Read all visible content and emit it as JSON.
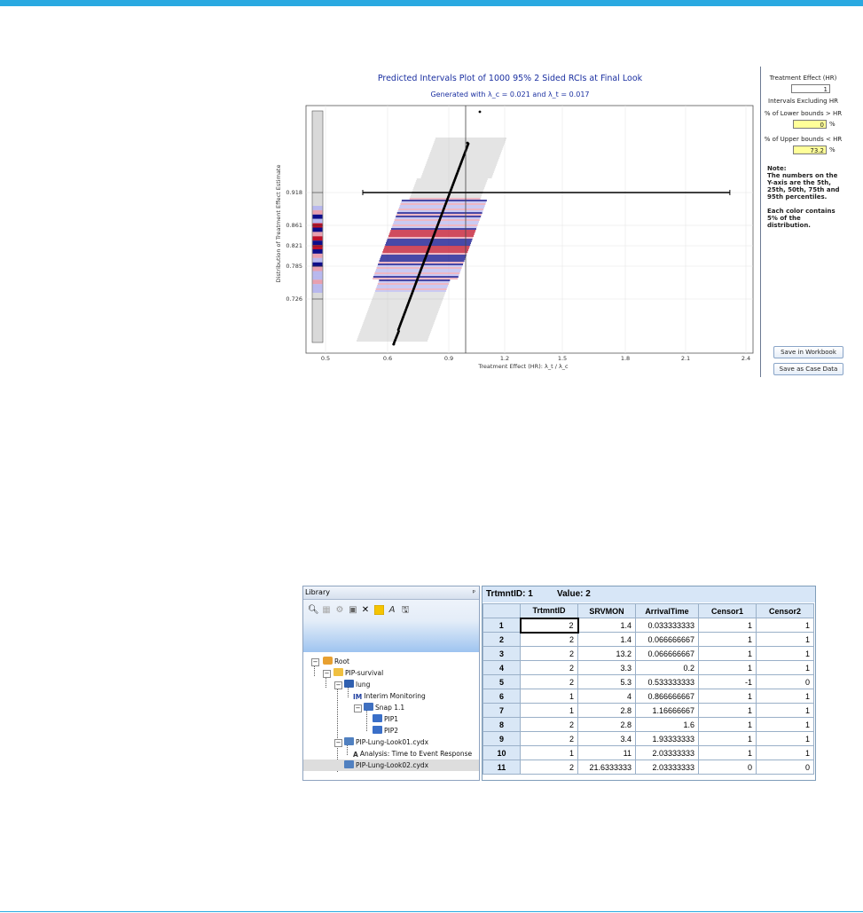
{
  "plot": {
    "title": "Predicted Intervals Plot of 1000 95% 2 Sided RCIs at Final Look",
    "subtitle": "Generated with λ_c = 0.021 and λ_t = 0.017",
    "xlabel": "Treatment Effect (HR): λ_t / λ_c",
    "ylabel": "Distribution of Treatment Effect Estimate",
    "xticks": [
      "0.5",
      "0.6",
      "0.9",
      "1.2",
      "1.5",
      "1.8",
      "2.1",
      "2.4"
    ],
    "yticks": [
      "0.918",
      "0.861",
      "0.821",
      "0.785",
      "0.726"
    ],
    "colors": {
      "title": "#1a2fa0",
      "dot": "#000000",
      "band_dark": "#0d0d8a",
      "band_red": "#c01028",
      "band_light": "#b8b8ee",
      "band_pink": "#e8a0b0",
      "gray_line": "#c8c8c8"
    }
  },
  "chart_data": {
    "type": "scatter",
    "title": "Predicted Intervals Plot of 1000 95% 2 Sided RCIs at Final Look",
    "subtitle": "Generated with λ_c = 0.021 and λ_t = 0.017",
    "xlabel": "Treatment Effect (HR): λ_t / λ_c",
    "ylabel": "Distribution of Treatment Effect Estimate",
    "x_ticks": [
      0.5,
      0.6,
      0.9,
      1.2,
      1.5,
      1.8,
      2.1,
      2.4
    ],
    "y_ticks": [
      0.918,
      0.861,
      0.821,
      0.785,
      0.726
    ],
    "reference_line_x": 1.0,
    "highlight_interval": {
      "estimate": 0.918,
      "lower": 0.56,
      "upper": 2.32
    },
    "point_estimate_range": [
      0.64,
      1.08
    ],
    "outlier_point": [
      1.08,
      0.98
    ],
    "num_intervals": 1000,
    "grid": true
  },
  "side_panel": {
    "treatment_effect_label": "Treatment Effect (HR)",
    "treatment_effect_value": "1",
    "intervals_excluding_label": "Intervals Excluding HR",
    "lower_bounds_label": "% of Lower bounds > HR",
    "lower_bounds_value": "0",
    "upper_bounds_label": "% of Upper bounds < HR",
    "upper_bounds_value": "73.2",
    "percent_unit": "%",
    "note_title": "Note:",
    "note_text": "The numbers on the Y-axis are the 5th, 25th, 50th, 75th and 95th percentiles.",
    "note_text2": "Each color contains 5% of the distribution.",
    "save_workbook": "Save in Workbook",
    "save_case_data": "Save as Case Data"
  },
  "library": {
    "title": "Library",
    "pin": "ᵖ",
    "toolbar_icons": [
      "search-icon",
      "grid-icon",
      "settings-icon",
      "save-icon",
      "delete-icon",
      "note-icon",
      "font-icon",
      "disk-icon"
    ],
    "tree": [
      {
        "label": "Root",
        "icon": "home-icon"
      },
      {
        "label": "PIP-survival",
        "icon": "folder-icon"
      },
      {
        "label": "lung",
        "icon": "chart-icon"
      },
      {
        "label": "Interim Monitoring",
        "prefix": "IM",
        "icon": "im-icon"
      },
      {
        "label": "Snap 1.1",
        "icon": "snap-icon"
      },
      {
        "label": "PIP1",
        "icon": "doc-icon"
      },
      {
        "label": "PIP2",
        "icon": "doc-icon"
      },
      {
        "label": "PIP-Lung-Look01.cydx",
        "icon": "table-icon"
      },
      {
        "label": "Analysis: Time to Event Response",
        "prefix": "A",
        "icon": "analysis-icon"
      },
      {
        "label": "PIP-Lung-Look02.cydx",
        "icon": "table-icon"
      }
    ]
  },
  "grid": {
    "header_id_label": "TrtmntID: 1",
    "header_value_label": "Value: 2",
    "columns": [
      "",
      "TrtmntID",
      "SRVMON",
      "ArrivalTime",
      "Censor1",
      "Censor2"
    ],
    "rows": [
      [
        "1",
        "2",
        "1.4",
        "0.033333333",
        "1",
        "1"
      ],
      [
        "2",
        "2",
        "1.4",
        "0.066666667",
        "1",
        "1"
      ],
      [
        "3",
        "2",
        "13.2",
        "0.066666667",
        "1",
        "1"
      ],
      [
        "4",
        "2",
        "3.3",
        "0.2",
        "1",
        "1"
      ],
      [
        "5",
        "2",
        "5.3",
        "0.533333333",
        "-1",
        "0"
      ],
      [
        "6",
        "1",
        "4",
        "0.866666667",
        "1",
        "1"
      ],
      [
        "7",
        "1",
        "2.8",
        "1.16666667",
        "1",
        "1"
      ],
      [
        "8",
        "2",
        "2.8",
        "1.6",
        "1",
        "1"
      ],
      [
        "9",
        "2",
        "3.4",
        "1.93333333",
        "1",
        "1"
      ],
      [
        "10",
        "1",
        "11",
        "2.03333333",
        "1",
        "1"
      ],
      [
        "11",
        "2",
        "21.6333333",
        "2.03333333",
        "0",
        "0"
      ]
    ]
  }
}
